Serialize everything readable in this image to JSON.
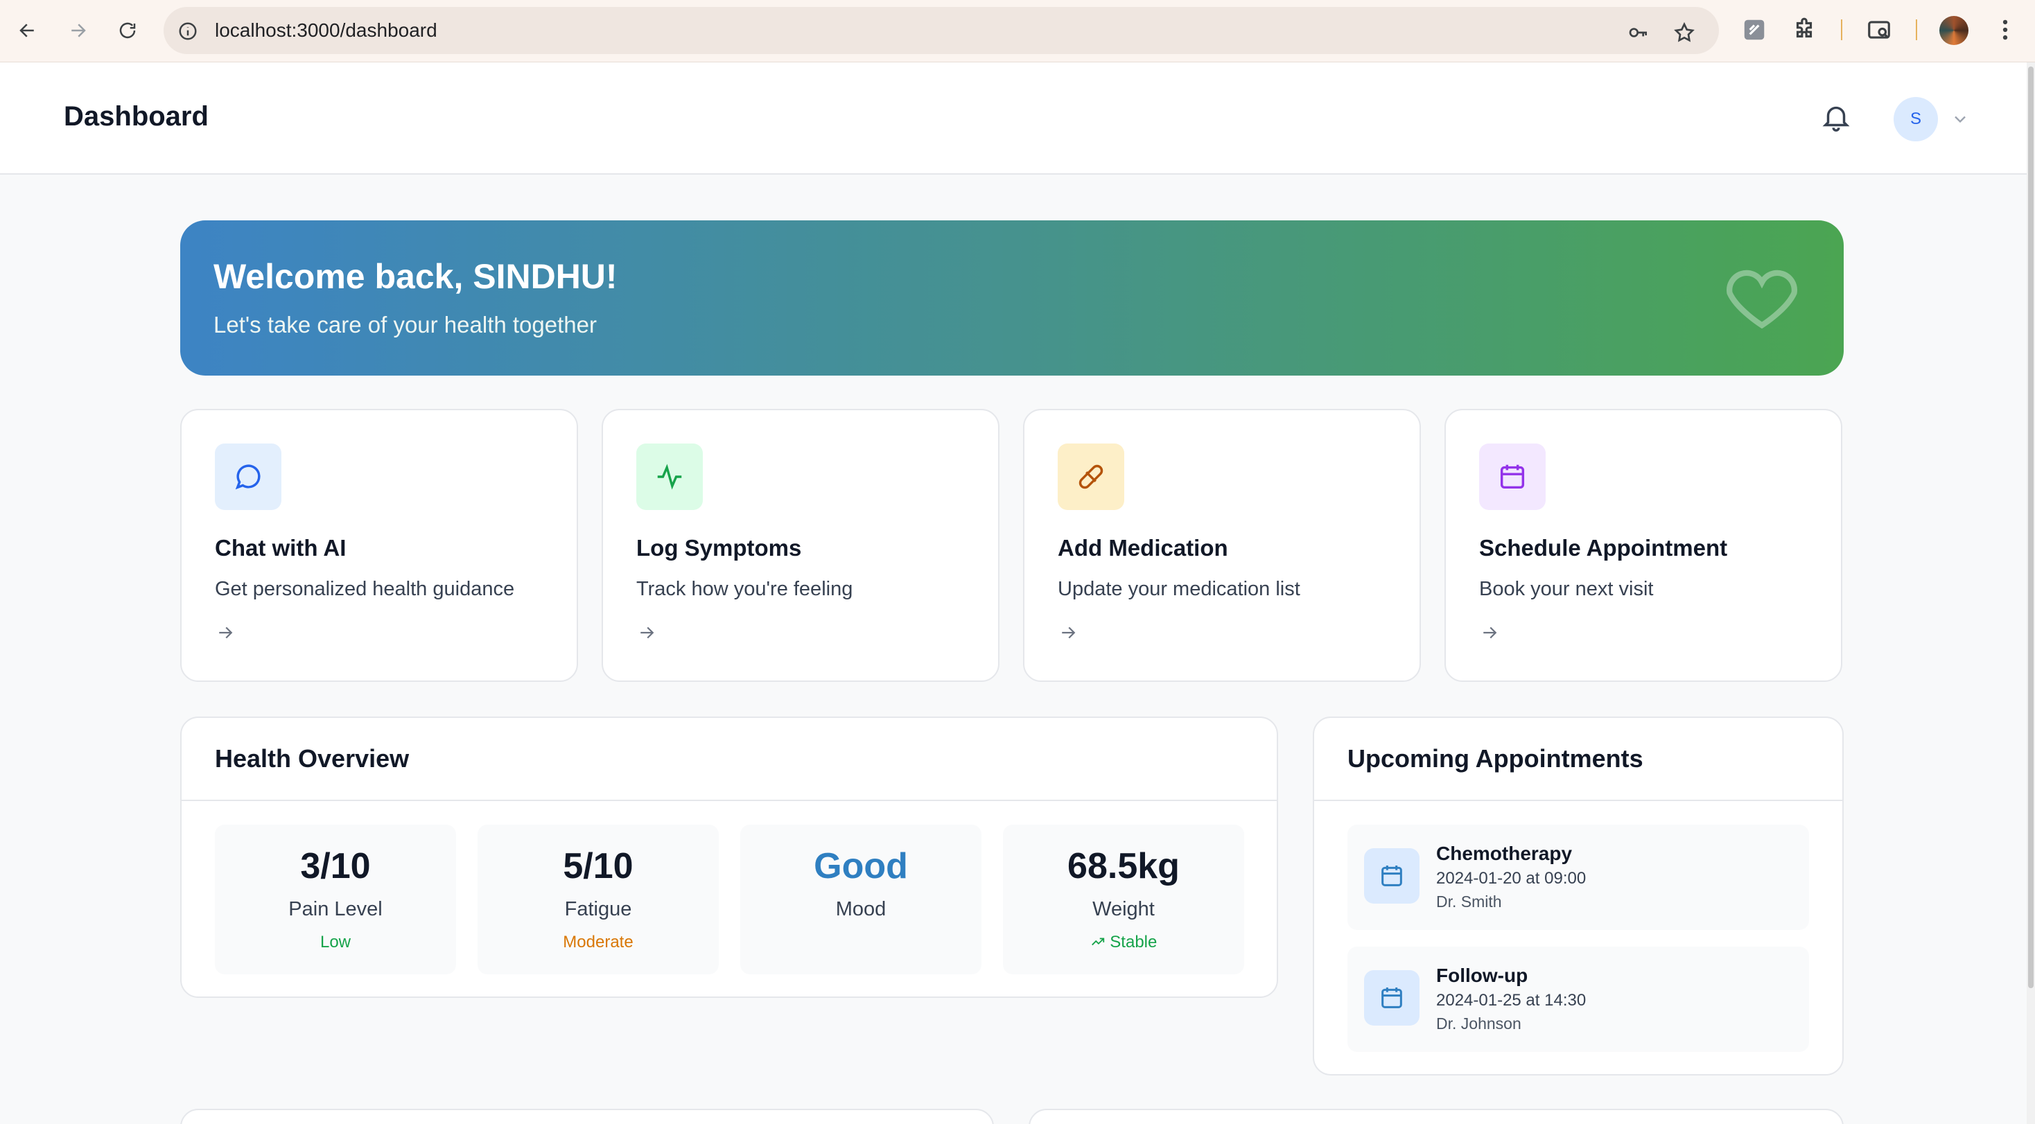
{
  "browser": {
    "url": "localhost:3000/dashboard"
  },
  "header": {
    "title": "Dashboard",
    "avatar_initial": "S"
  },
  "banner": {
    "title": "Welcome back, SINDHU!",
    "subtitle": "Let's take care of your health together"
  },
  "quick_actions": [
    {
      "title": "Chat with AI",
      "description": "Get personalized health guidance",
      "icon": "chat-icon",
      "color": "#2563eb",
      "bg": "#e3effd"
    },
    {
      "title": "Log Symptoms",
      "description": "Track how you're feeling",
      "icon": "activity-icon",
      "color": "#16a34a",
      "bg": "#dcfce7"
    },
    {
      "title": "Add Medication",
      "description": "Update your medication list",
      "icon": "pill-icon",
      "color": "#b45309",
      "bg": "#fdefc8"
    },
    {
      "title": "Schedule Appointment",
      "description": "Book your next visit",
      "icon": "calendar-icon",
      "color": "#9333ea",
      "bg": "#f3e8ff"
    }
  ],
  "health_overview": {
    "title": "Health Overview",
    "metrics": [
      {
        "value": "3/10",
        "label": "Pain Level",
        "status": "Low",
        "status_color": "#16a34a"
      },
      {
        "value": "5/10",
        "label": "Fatigue",
        "status": "Moderate",
        "status_color": "#d97706"
      },
      {
        "value": "Good",
        "label": "Mood",
        "status": "",
        "value_color": "#2f7fc1"
      },
      {
        "value": "68.5kg",
        "label": "Weight",
        "status": "Stable",
        "status_color": "#16a34a"
      }
    ]
  },
  "appointments": {
    "title": "Upcoming Appointments",
    "items": [
      {
        "name": "Chemotherapy",
        "when": "2024-01-20 at 09:00",
        "doctor": "Dr. Smith"
      },
      {
        "name": "Follow-up",
        "when": "2024-01-25 at 14:30",
        "doctor": "Dr. Johnson"
      }
    ]
  }
}
